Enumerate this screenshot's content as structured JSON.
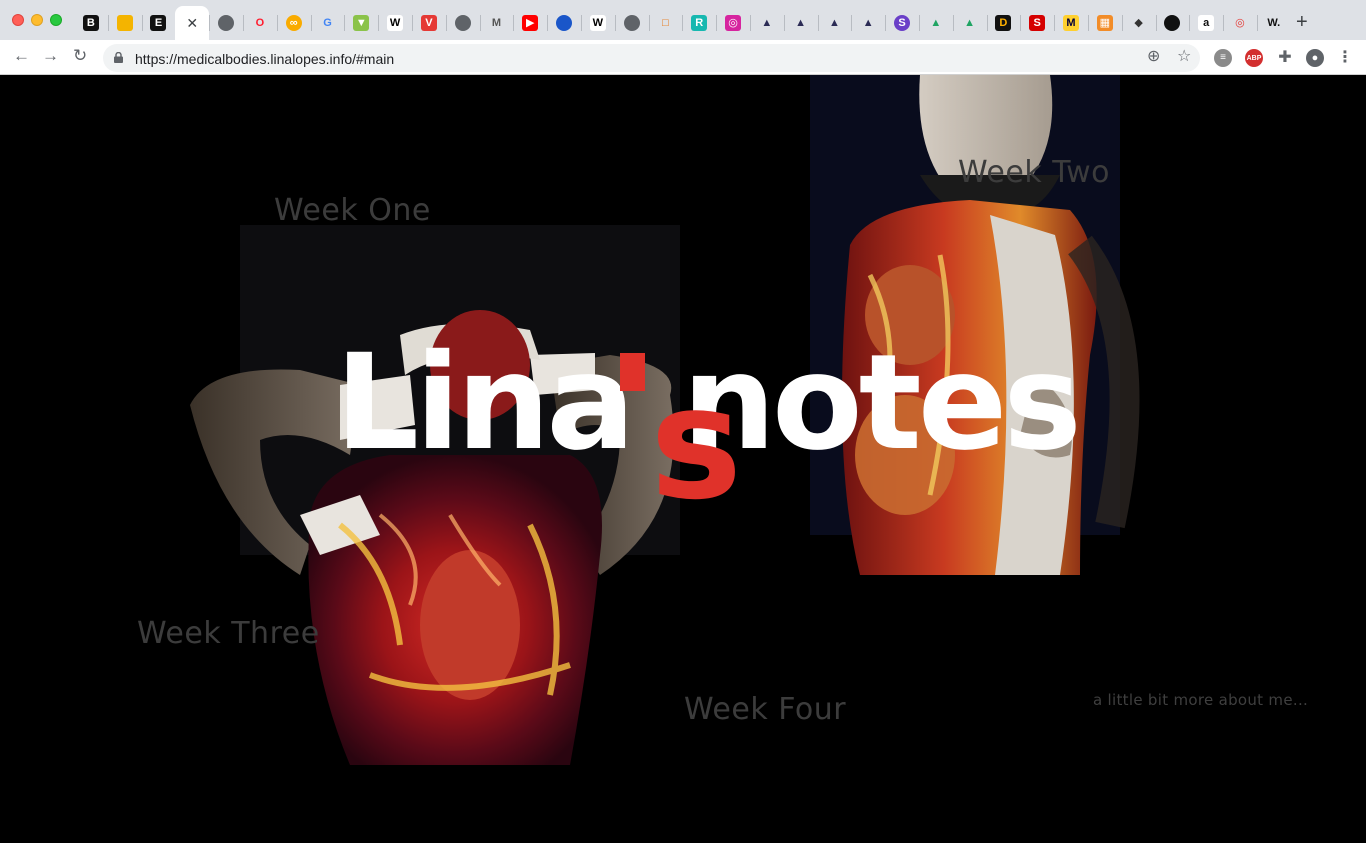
{
  "browser": {
    "tabs": [
      {
        "icon": "b-icon",
        "glyph": "B",
        "bg": "#111111",
        "fg": "#ffffff"
      },
      {
        "icon": "slides-icon",
        "glyph": "",
        "bg": "#f4b400",
        "fg": "#ffffff"
      },
      {
        "icon": "e-icon",
        "glyph": "E",
        "bg": "#111111",
        "fg": "#ffffff"
      },
      {
        "icon": "close-icon",
        "glyph": "✕",
        "bg": "transparent",
        "fg": "#3c4043",
        "active": true
      },
      {
        "icon": "globe-icon",
        "glyph": "",
        "bg": "#5f6368",
        "fg": "#ffffff",
        "round": true
      },
      {
        "icon": "opera-icon",
        "glyph": "O",
        "bg": "transparent",
        "fg": "#ff1b2d"
      },
      {
        "icon": "infinity-icon",
        "glyph": "∞",
        "bg": "#f9ab00",
        "fg": "#ffffff",
        "round": true
      },
      {
        "icon": "google-icon",
        "glyph": "G",
        "bg": "transparent",
        "fg": "#4285f4"
      },
      {
        "icon": "hype-icon",
        "glyph": "▼",
        "bg": "#8bc34a",
        "fg": "#ffffff"
      },
      {
        "icon": "wikipedia-icon",
        "glyph": "W",
        "bg": "#ffffff",
        "fg": "#000000"
      },
      {
        "icon": "vivaldi-icon",
        "glyph": "V",
        "bg": "#e53935",
        "fg": "#ffffff"
      },
      {
        "icon": "globe-icon",
        "glyph": "",
        "bg": "#5f6368",
        "fg": "#ffffff",
        "round": true
      },
      {
        "icon": "medium-icon",
        "glyph": "M",
        "bg": "transparent",
        "fg": "#555555"
      },
      {
        "icon": "youtube-icon",
        "glyph": "▶",
        "bg": "#ff0000",
        "fg": "#ffffff"
      },
      {
        "icon": "blue-circle-icon",
        "glyph": "",
        "bg": "#1a56c9",
        "fg": "#ffffff",
        "round": true
      },
      {
        "icon": "wikipedia-icon",
        "glyph": "W",
        "bg": "#ffffff",
        "fg": "#000000"
      },
      {
        "icon": "globe-icon",
        "glyph": "",
        "bg": "#5f6368",
        "fg": "#ffffff",
        "round": true
      },
      {
        "icon": "book-icon",
        "glyph": "□",
        "bg": "transparent",
        "fg": "#e8710a"
      },
      {
        "icon": "r-icon",
        "glyph": "R",
        "bg": "#17b8b0",
        "fg": "#ffffff"
      },
      {
        "icon": "instagram-icon",
        "glyph": "◎",
        "bg": "#d6249f",
        "fg": "#ffffff"
      },
      {
        "icon": "artstation-icon",
        "glyph": "▲",
        "bg": "transparent",
        "fg": "#2b2b55"
      },
      {
        "icon": "artstation-icon",
        "glyph": "▲",
        "bg": "transparent",
        "fg": "#2b2b55"
      },
      {
        "icon": "artstation-icon",
        "glyph": "▲",
        "bg": "transparent",
        "fg": "#2b2b55"
      },
      {
        "icon": "artstation-icon",
        "glyph": "▲",
        "bg": "transparent",
        "fg": "#2b2b55"
      },
      {
        "icon": "s-circle-icon",
        "glyph": "S",
        "bg": "#6a3fc8",
        "fg": "#ffffff",
        "round": true
      },
      {
        "icon": "drive-icon",
        "glyph": "▲",
        "bg": "transparent",
        "fg": "#1fa463"
      },
      {
        "icon": "drive-icon",
        "glyph": "▲",
        "bg": "transparent",
        "fg": "#1fa463"
      },
      {
        "icon": "d-icon",
        "glyph": "D",
        "bg": "#111111",
        "fg": "#ffb000"
      },
      {
        "icon": "s-red-icon",
        "glyph": "S",
        "bg": "#d50000",
        "fg": "#ffffff"
      },
      {
        "icon": "miro-icon",
        "glyph": "M",
        "bg": "#ffd02f",
        "fg": "#050038"
      },
      {
        "icon": "grid-icon",
        "glyph": "▦",
        "bg": "#f28c28",
        "fg": "#ffffff"
      },
      {
        "icon": "diamond-icon",
        "glyph": "◆",
        "bg": "transparent",
        "fg": "#333333"
      },
      {
        "icon": "black-circle-icon",
        "glyph": "",
        "bg": "#111111",
        "fg": "#ffffff",
        "round": true
      },
      {
        "icon": "amazon-icon",
        "glyph": "a",
        "bg": "#ffffff",
        "fg": "#111111"
      },
      {
        "icon": "target-icon",
        "glyph": "◎",
        "bg": "transparent",
        "fg": "#e53935"
      },
      {
        "icon": "w-icon",
        "glyph": "W.",
        "bg": "transparent",
        "fg": "#111111"
      }
    ],
    "new_tab_label": "+",
    "url": "https://medicalbodies.linalopes.info/#main"
  },
  "site": {
    "title_part1": "Lina",
    "title_s": "s",
    "title_part2": "notes",
    "week_one": "Week One",
    "week_two": "Week Two",
    "week_three": "Week Three",
    "week_four": "Week Four",
    "about": "a little bit more about me..."
  },
  "colors": {
    "accent": "#e0322a",
    "link_text": "#3c3c3c",
    "background": "#000000"
  }
}
